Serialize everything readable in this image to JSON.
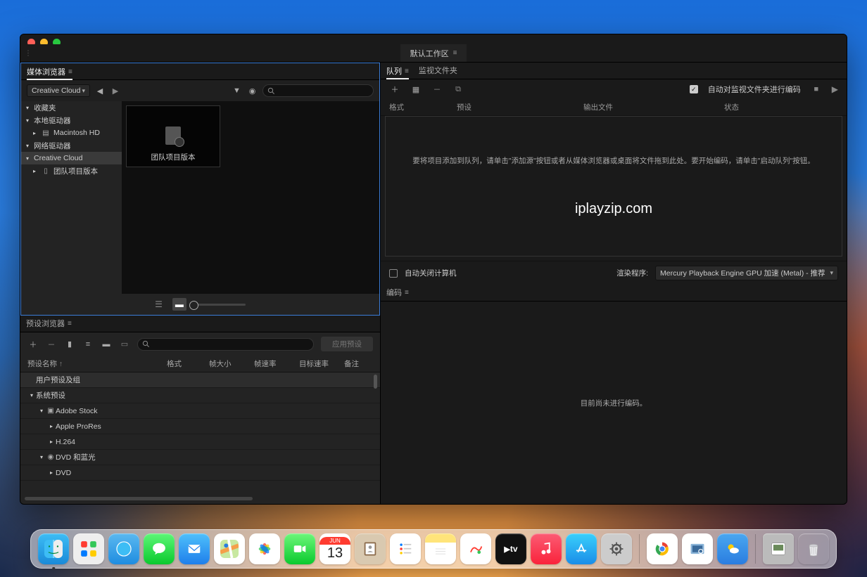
{
  "workspace_tab": "默认工作区",
  "media_browser": {
    "tab": "媒体浏览器",
    "location_dropdown": "Creative Cloud",
    "tree": {
      "favorites": "收藏夹",
      "local": "本地驱动器",
      "local_hd": "Macintosh HD",
      "network": "网络驱动器",
      "cc": "Creative Cloud",
      "team": "团队项目版本"
    },
    "grid_item": "团队项目版本"
  },
  "preset_browser": {
    "tab": "预设浏览器",
    "apply_button": "应用预设",
    "headers": {
      "name": "预设名称",
      "format": "格式",
      "frame_size": "帧大小",
      "frame_rate": "帧速率",
      "target_rate": "目标速率",
      "note": "备注"
    },
    "rows": {
      "user": "用户预设及组",
      "system": "系统预设",
      "adobe_stock": "Adobe Stock",
      "prores": "Apple ProRes",
      "h264": "H.264",
      "dvd_bd": "DVD 和蓝光",
      "dvd": "DVD"
    }
  },
  "queue": {
    "tab_queue": "队列",
    "tab_watch": "监视文件夹",
    "auto_encode_label": "自动对监视文件夹进行编码",
    "headers": {
      "format": "格式",
      "preset": "预设",
      "output": "输出文件",
      "status": "状态"
    },
    "empty_msg": "要将项目添加到队列，请单击\"添加源\"按钮或者从媒体浏览器或桌面将文件拖到此处。要开始编码，请单击\"启动队列\"按钮。",
    "watermark": "iplayzip.com",
    "auto_shutdown": "自动关闭计算机",
    "renderer_label": "渲染程序:",
    "renderer_value": "Mercury Playback Engine GPU 加速 (Metal) - 推荐"
  },
  "encode": {
    "tab": "编码",
    "empty_msg": "目前尚未进行编码。"
  },
  "dock": {
    "cal_month": "JUN",
    "cal_day": "13",
    "tv": "tv"
  }
}
